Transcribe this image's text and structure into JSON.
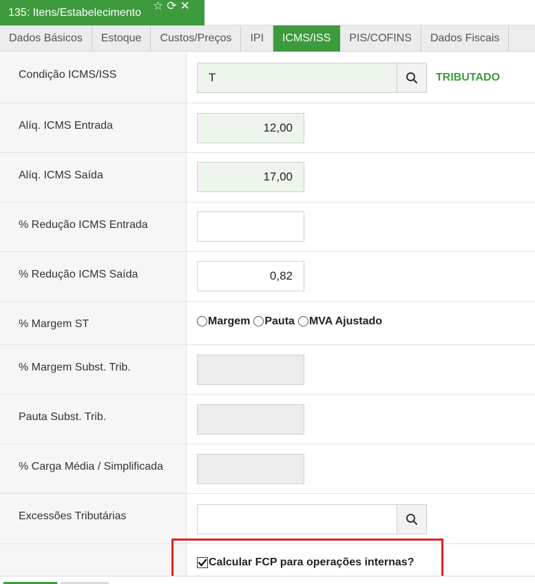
{
  "window": {
    "title": "135: Itens/Estabelecimento"
  },
  "tabs": [
    {
      "label": "Dados Básicos"
    },
    {
      "label": "Estoque"
    },
    {
      "label": "Custos/Preços"
    },
    {
      "label": "IPI"
    },
    {
      "label": "ICMS/ISS",
      "active": true
    },
    {
      "label": "PIS/COFINS"
    },
    {
      "label": "Dados Fiscais"
    }
  ],
  "fields": {
    "condicao": {
      "label": "Condição ICMS/ISS",
      "value": "T",
      "status": "TRIBUTADO"
    },
    "aliq_entrada": {
      "label": "Alíq. ICMS Entrada",
      "value": "12,00"
    },
    "aliq_saida": {
      "label": "Alíq. ICMS Saída",
      "value": "17,00"
    },
    "reducao_entrada": {
      "label": "% Redução ICMS Entrada",
      "value": ""
    },
    "reducao_saida": {
      "label": "% Redução ICMS Saída",
      "value": "0,82"
    },
    "margem_st": {
      "label": "% Margem ST",
      "options": [
        "Margem",
        "Pauta",
        "MVA Ajustado"
      ]
    },
    "margem_subst": {
      "label": "% Margem Subst. Trib.",
      "value": ""
    },
    "pauta_subst": {
      "label": "Pauta Subst. Trib.",
      "value": ""
    },
    "carga_media": {
      "label": "% Carga Média / Simplificada",
      "value": ""
    },
    "excessoes": {
      "label": "Excessões Tributárias",
      "value": ""
    }
  },
  "fcp": {
    "label": "Calcular FCP para operações internas?",
    "checked": true
  },
  "colors": {
    "accent": "#3d9b3d",
    "highlight": "#e02020"
  }
}
